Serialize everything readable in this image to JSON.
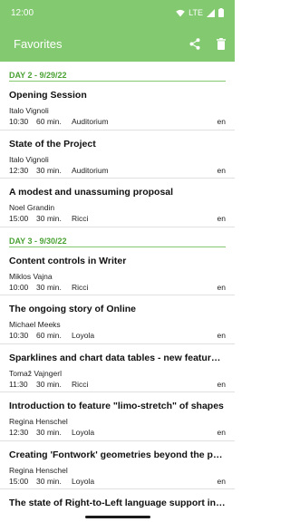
{
  "status": {
    "time": "12:00",
    "network": "LTE",
    "icons": [
      "wifi-icon",
      "signal-icon",
      "battery-icon"
    ]
  },
  "app_bar": {
    "title": "Favorites",
    "actions": [
      "share-icon",
      "delete-icon"
    ],
    "color": "#82c96f"
  },
  "days": [
    {
      "label": "DAY 2 - 9/29/22",
      "sessions": [
        {
          "title": "Opening Session",
          "speaker": "Italo Vignoli",
          "time": "10:30",
          "duration": "60 min.",
          "room": "Auditorium",
          "lang": "en"
        },
        {
          "title": "State of the Project",
          "speaker": "Italo Vignoli",
          "time": "12:30",
          "duration": "30 min.",
          "room": "Auditorium",
          "lang": "en"
        },
        {
          "title": "A modest and unassuming proposal",
          "speaker": "Noel Grandin",
          "time": "15:00",
          "duration": "30 min.",
          "room": "Ricci",
          "lang": "en"
        }
      ]
    },
    {
      "label": "DAY 3 - 9/30/22",
      "sessions": [
        {
          "title": "Content controls in Writer",
          "speaker": "Miklos Vajna",
          "time": "10:00",
          "duration": "30 min.",
          "room": "Ricci",
          "lang": "en"
        },
        {
          "title": "The ongoing story of Online",
          "speaker": "Michael Meeks",
          "time": "10:30",
          "duration": "60 min.",
          "room": "Loyola",
          "lang": "en"
        },
        {
          "title": "Sparklines and chart data tables - new features in LibreOffice",
          "speaker": "Tomaž Vajngerl",
          "time": "11:30",
          "duration": "30 min.",
          "room": "Ricci",
          "lang": "en"
        },
        {
          "title": "Introduction to feature \"limo-stretch\" of shapes",
          "speaker": "Regina Henschel",
          "time": "12:30",
          "duration": "30 min.",
          "room": "Loyola",
          "lang": "en"
        },
        {
          "title": "Creating 'Fontwork' geometries beyond the predefined ones",
          "speaker": "Regina Henschel",
          "time": "15:00",
          "duration": "30 min.",
          "room": "Loyola",
          "lang": "en"
        },
        {
          "title": "The state of Right-to-Left language support in LibreOffice",
          "speaker": "",
          "time": "",
          "duration": "",
          "room": "",
          "lang": ""
        }
      ]
    }
  ]
}
